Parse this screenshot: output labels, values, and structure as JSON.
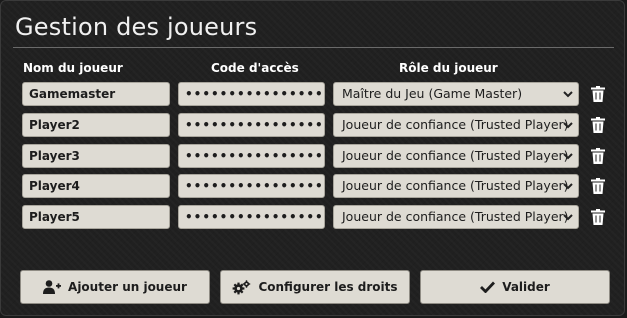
{
  "title": "Gestion des joueurs",
  "columns": {
    "name": "Nom du joueur",
    "code": "Code d'accès",
    "role": "Rôle du joueur"
  },
  "players": [
    {
      "name": "Gamemaster",
      "code": "••••••••••••••••",
      "role": "Maître du Jeu (Game Master)"
    },
    {
      "name": "Player2",
      "code": "••••••••••••••••",
      "role": "Joueur de confiance (Trusted Player)"
    },
    {
      "name": "Player3",
      "code": "••••••••••••••••",
      "role": "Joueur de confiance (Trusted Player)"
    },
    {
      "name": "Player4",
      "code": "••••••••••••••••",
      "role": "Joueur de confiance (Trusted Player)"
    },
    {
      "name": "Player5",
      "code": "••••••••••••••••",
      "role": "Joueur de confiance (Trusted Player)"
    }
  ],
  "buttons": {
    "add_player": "Ajouter un joueur",
    "configure": "Configurer les droits",
    "submit": "Valider"
  },
  "icons": {
    "add_player": "user-plus-icon",
    "configure": "cogs-icon",
    "submit": "check-icon",
    "delete": "trash-icon",
    "dropdown": "chevron-down-icon"
  },
  "colors": {
    "background": "#202020",
    "field": "#dedbd3",
    "text_light": "#f0f0f0"
  }
}
